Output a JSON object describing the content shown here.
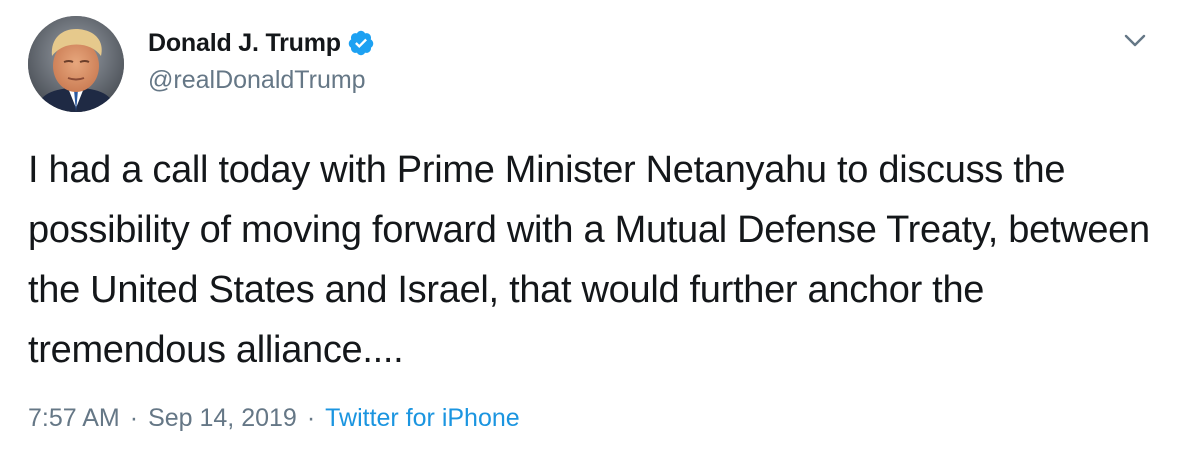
{
  "author": {
    "display_name": "Donald J. Trump",
    "handle": "@realDonaldTrump",
    "verified": true,
    "avatar_icon": "profile-photo"
  },
  "tweet": {
    "text": "I had a call today with Prime Minister Netanyahu to discuss the possibility of moving forward with a Mutual Defense Treaty, between the United States and Israel, that would further anchor the tremendous alliance....",
    "time": "7:57 AM",
    "date": "Sep 14, 2019",
    "separator": "·",
    "source": "Twitter for iPhone"
  },
  "menu": {
    "icon": "chevron-down-icon"
  },
  "colors": {
    "text": "#14171a",
    "secondary": "#657786",
    "link": "#1b95e0",
    "verified_badge": "#1da1f2"
  }
}
